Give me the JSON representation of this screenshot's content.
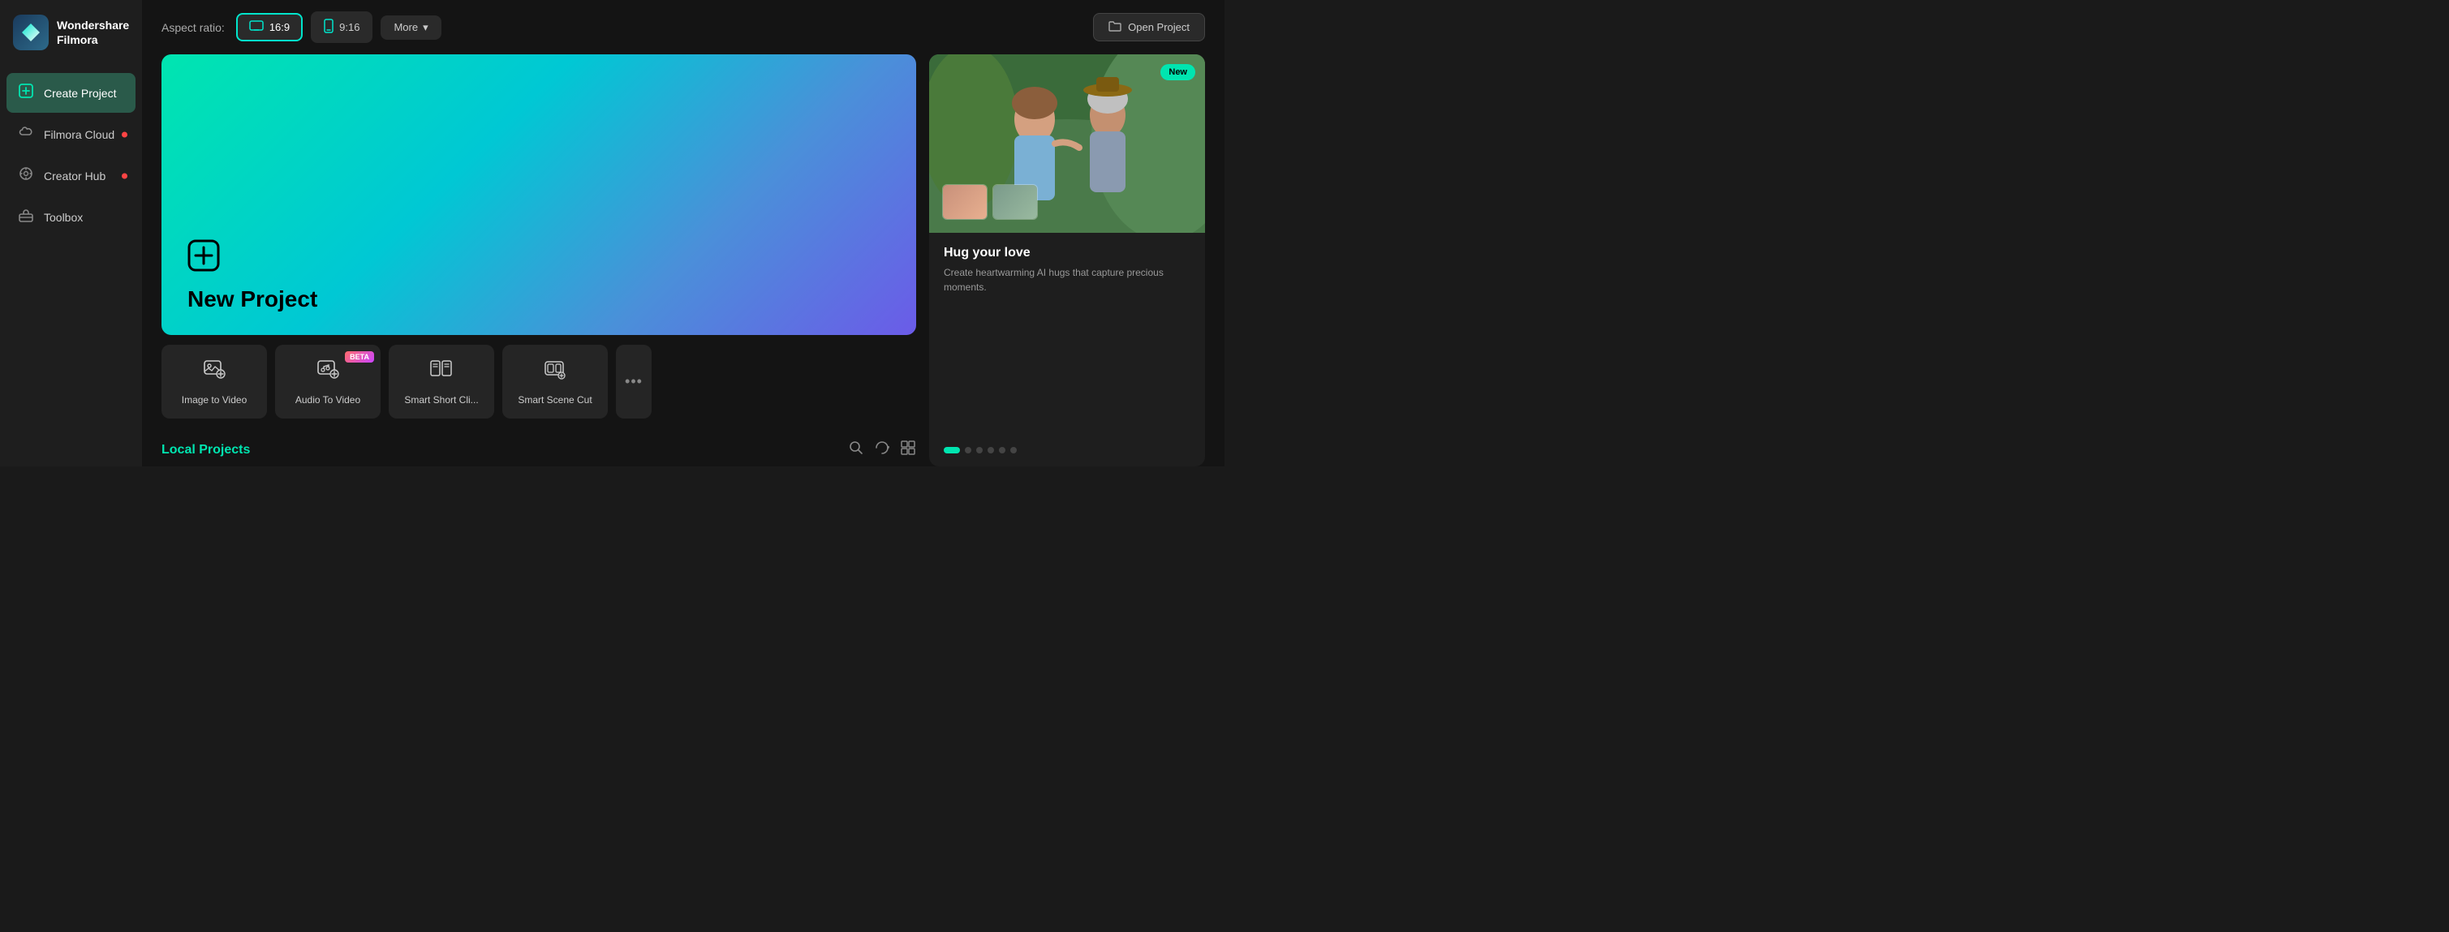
{
  "app": {
    "name": "Wondershare",
    "subtitle": "Filmora"
  },
  "sidebar": {
    "items": [
      {
        "id": "create-project",
        "label": "Create Project",
        "icon": "plus-square",
        "active": true,
        "dot": false
      },
      {
        "id": "filmora-cloud",
        "label": "Filmora Cloud",
        "icon": "cloud",
        "active": false,
        "dot": true
      },
      {
        "id": "creator-hub",
        "label": "Creator Hub",
        "icon": "lightbulb",
        "active": false,
        "dot": true
      },
      {
        "id": "toolbox",
        "label": "Toolbox",
        "icon": "toolbox",
        "active": false,
        "dot": false
      }
    ]
  },
  "topbar": {
    "aspect_ratio_label": "Aspect ratio:",
    "aspect_options": [
      {
        "id": "16-9",
        "label": "16:9",
        "active": true
      },
      {
        "id": "9-16",
        "label": "9:16",
        "active": false
      }
    ],
    "more_label": "More",
    "open_project_label": "Open Project"
  },
  "new_project": {
    "title": "New Project",
    "plus_icon": "⊕"
  },
  "tool_cards": [
    {
      "id": "image-to-video",
      "label": "Image to Video",
      "beta": false
    },
    {
      "id": "audio-to-video",
      "label": "Audio To Video",
      "beta": true
    },
    {
      "id": "smart-short-clip",
      "label": "Smart Short Cli...",
      "beta": false
    },
    {
      "id": "smart-scene-cut",
      "label": "Smart Scene Cut",
      "beta": false
    }
  ],
  "local_projects": {
    "title": "Local Projects"
  },
  "featured": {
    "new_badge": "New",
    "title": "Hug your love",
    "description": "Create heartwarming AI hugs that capture precious moments.",
    "carousel_dots": 6,
    "active_dot": 0
  }
}
